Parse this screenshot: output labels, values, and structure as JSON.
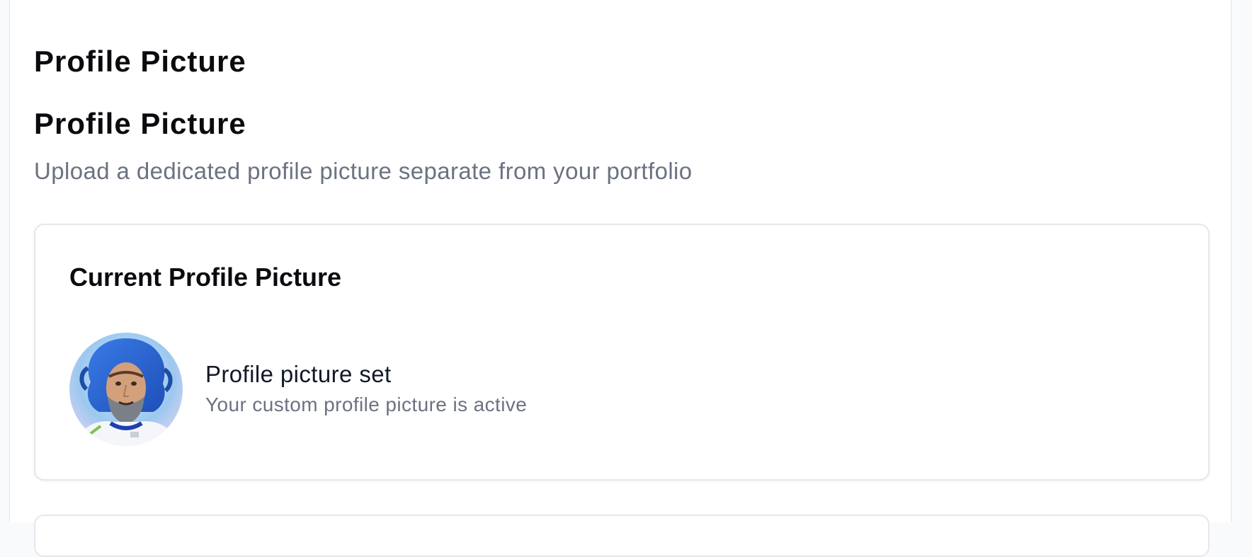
{
  "page": {
    "heading_primary": "Profile Picture",
    "heading_secondary": "Profile Picture",
    "subtitle": "Upload a dedicated profile picture separate from your portfolio"
  },
  "current_picture_card": {
    "title": "Current Profile Picture",
    "status_title": "Profile picture set",
    "status_subtitle": "Your custom profile picture is active",
    "avatar_icon": "astronaut-portrait-avatar"
  },
  "colors": {
    "text_primary": "#0b0b0f",
    "text_muted": "#6b7280",
    "border": "#e5e7eb",
    "avatar_hair": "#2f6fd6"
  }
}
